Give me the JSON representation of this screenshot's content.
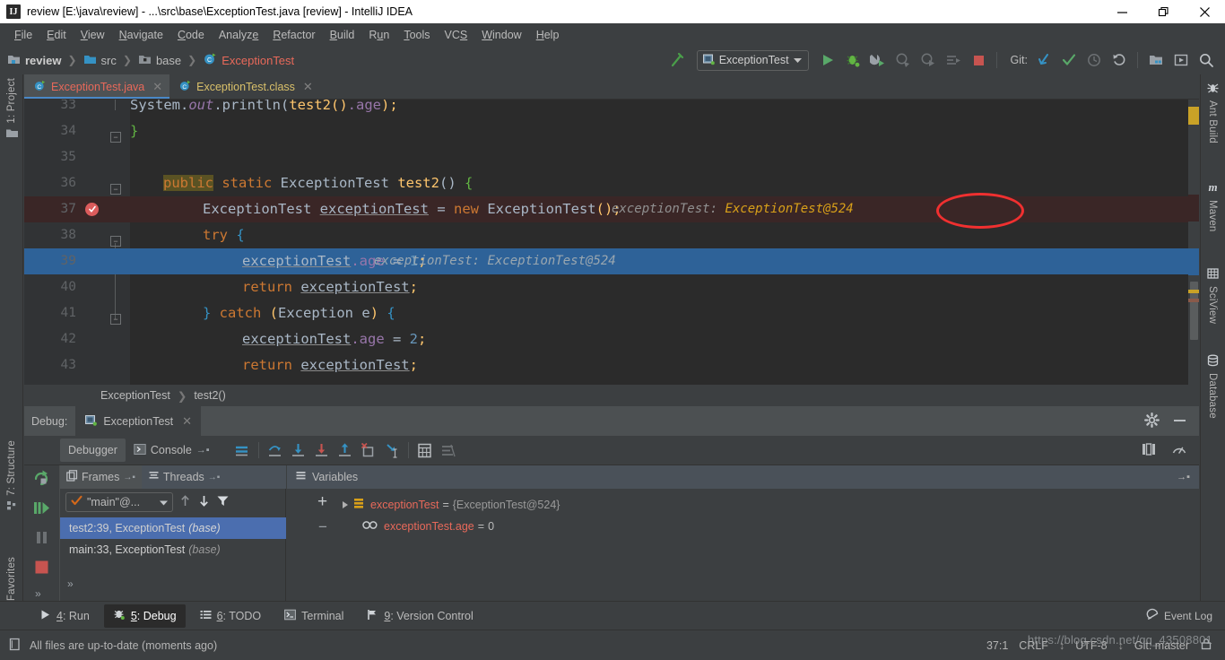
{
  "window": {
    "title": "review [E:\\java\\review] - ...\\src\\base\\ExceptionTest.java [review] - IntelliJ IDEA",
    "app_icon": "IJ",
    "minimize": "minimize-icon",
    "maximize": "restore-icon",
    "close": "close-icon"
  },
  "menu": {
    "items": [
      {
        "label": "File"
      },
      {
        "label": "Edit"
      },
      {
        "label": "View"
      },
      {
        "label": "Navigate"
      },
      {
        "label": "Code"
      },
      {
        "label": "Analyze"
      },
      {
        "label": "Refactor"
      },
      {
        "label": "Build"
      },
      {
        "label": "Run"
      },
      {
        "label": "Tools"
      },
      {
        "label": "VCS"
      },
      {
        "label": "Window"
      },
      {
        "label": "Help"
      }
    ]
  },
  "navbar": {
    "breadcrumb": [
      {
        "label": "review",
        "icon": "module-icon"
      },
      {
        "label": "src",
        "icon": "source-folder-icon"
      },
      {
        "label": "base",
        "icon": "package-icon"
      },
      {
        "label": "ExceptionTest",
        "icon": "class-icon"
      }
    ],
    "run_config": "ExceptionTest",
    "git_label": "Git:",
    "buttons": [
      {
        "name": "build-hammer-icon"
      },
      {
        "name": "run-icon"
      },
      {
        "name": "debug-icon"
      },
      {
        "name": "run-with-coverage-icon"
      },
      {
        "name": "attach-profiler-icon"
      },
      {
        "name": "profile-icon"
      },
      {
        "name": "run-anything-icon"
      },
      {
        "name": "stop-icon"
      },
      {
        "name": "update-project-icon"
      },
      {
        "name": "commit-icon"
      },
      {
        "name": "history-icon"
      },
      {
        "name": "rollback-icon"
      },
      {
        "name": "settings-icon"
      },
      {
        "name": "project-structure-icon"
      },
      {
        "name": "search-everywhere-icon"
      }
    ]
  },
  "left_tool_strip": [
    {
      "label": "1: Project",
      "icon": "folder-icon"
    },
    {
      "label": "7: Structure",
      "icon": "structure-icon"
    },
    {
      "label": "2: Favorites",
      "icon": "star-icon"
    }
  ],
  "right_tool_strip": [
    {
      "label": "Ant Build",
      "icon": "ant-icon"
    },
    {
      "label": "Maven",
      "icon": "maven-icon"
    },
    {
      "label": "SciView",
      "icon": "sciview-icon"
    },
    {
      "label": "Database",
      "icon": "database-icon"
    }
  ],
  "editor_tabs": [
    {
      "label": "ExceptionTest.java",
      "type": "java",
      "active": true
    },
    {
      "label": "ExceptionTest.class",
      "type": "class",
      "active": false
    }
  ],
  "editor": {
    "breadcrumb": [
      "ExceptionTest",
      "test2()"
    ],
    "lines": [
      {
        "num": "33",
        "state": "partial"
      },
      {
        "num": "34",
        "state": "normal"
      },
      {
        "num": "35",
        "state": "normal"
      },
      {
        "num": "36",
        "state": "normal"
      },
      {
        "num": "37",
        "state": "breakpoint"
      },
      {
        "num": "38",
        "state": "normal"
      },
      {
        "num": "39",
        "state": "execution"
      },
      {
        "num": "40",
        "state": "normal"
      },
      {
        "num": "41",
        "state": "normal"
      },
      {
        "num": "42",
        "state": "normal"
      },
      {
        "num": "43",
        "state": "normal"
      }
    ],
    "code": {
      "l33_system": "System.",
      "l33_out": "out",
      "l33_println": ".println(",
      "l33_call": "test2()",
      "l33_age": ".age",
      "l33_end": ");",
      "l34": "}",
      "l36_public": "public",
      "l36_static": " static ",
      "l36_type": "ExceptionTest",
      "l36_name": " test2",
      "l36_paren": "() ",
      "l36_brace": "{",
      "l37_type": "ExceptionTest ",
      "l37_var": "exceptionTest",
      "l37_eq": " = ",
      "l37_new": "new ",
      "l37_ctor": "ExceptionTest",
      "l37_end": "();",
      "l38_try": "try",
      "l38_brace": " {",
      "l39_var": "exceptionTest",
      "l39_field": ".age",
      "l39_eq": " = ",
      "l39_num": "1",
      "l39_semi": ";",
      "l40_return": "return ",
      "l40_var": "exceptionTest",
      "l40_semi": ";",
      "l41_brace": "} ",
      "l41_catch": "catch ",
      "l41_open": "(",
      "l41_exc": "Exception",
      "l41_e": " e",
      "l41_close": ") ",
      "l41_obrace": "{",
      "l42_var": "exceptionTest",
      "l42_field": ".age",
      "l42_eq": " = ",
      "l42_num": "2",
      "l42_semi": ";",
      "l43_return": "return ",
      "l43_var": "exceptionTest",
      "l43_semi": ";"
    },
    "inline_hints": {
      "line37_label": "exceptionTest: ",
      "line37_value": "ExceptionTest@524",
      "line39_label": "exceptionTest: ",
      "line39_value": "ExceptionTest@524"
    },
    "annotation": {
      "shape": "red-ellipse",
      "color": "#f03030"
    }
  },
  "debug": {
    "title_label": "Debug:",
    "session_tab": "ExceptionTest",
    "tabs": [
      {
        "label": "Debugger",
        "selected": true,
        "icon": null
      },
      {
        "label": "Console",
        "selected": false,
        "icon": "console-icon"
      }
    ],
    "session_controls": [
      {
        "name": "rerun-icon"
      },
      {
        "name": "resume-program-icon"
      },
      {
        "name": "pause-program-icon"
      },
      {
        "name": "stop-icon"
      },
      {
        "name": "more-chevrons-icon"
      }
    ],
    "step_buttons": [
      {
        "name": "show-execution-point-icon"
      },
      {
        "name": "step-over-icon"
      },
      {
        "name": "step-into-icon"
      },
      {
        "name": "force-step-into-icon"
      },
      {
        "name": "step-out-icon"
      },
      {
        "name": "drop-frame-icon"
      },
      {
        "name": "run-to-cursor-icon"
      },
      {
        "name": "evaluate-expression-icon"
      },
      {
        "name": "mute-breakpoints-icon"
      }
    ],
    "header_right": [
      {
        "name": "settings-gear-icon"
      },
      {
        "name": "hide-icon"
      }
    ],
    "toolbar_right": [
      {
        "name": "layout-icon"
      },
      {
        "name": "performance-icon"
      }
    ],
    "frames": {
      "tab_frames": "Frames",
      "tab_threads": "Threads",
      "thread_selector": "\"main\"@...",
      "items": [
        {
          "label": "test2:39, ExceptionTest",
          "suffix": "(base)",
          "selected": true
        },
        {
          "label": "main:33, ExceptionTest",
          "suffix": "(base)",
          "selected": false
        }
      ],
      "buttons": [
        {
          "name": "arrow-up-icon"
        },
        {
          "name": "arrow-down-icon"
        },
        {
          "name": "filter-icon"
        }
      ]
    },
    "variables": {
      "header": "Variables",
      "add_button": "+",
      "remove_button": "−",
      "rows": [
        {
          "expandable": true,
          "icon": "object-icon",
          "name": "exceptionTest",
          "eq": "=",
          "value": "{ExceptionTest@524}",
          "indent": 0
        },
        {
          "expandable": false,
          "icon": "watch-icon",
          "name": "exceptionTest.age",
          "eq": "=",
          "value": "0",
          "indent": 1
        }
      ]
    }
  },
  "bottom_bar": {
    "items": [
      {
        "label": "4: Run",
        "icon": "run-icon",
        "selected": false
      },
      {
        "label": "5: Debug",
        "icon": "debug-bug-icon",
        "selected": true
      },
      {
        "label": "6: TODO",
        "icon": "todo-icon",
        "selected": false
      },
      {
        "label": "Terminal",
        "icon": "terminal-icon",
        "selected": false
      },
      {
        "label": "9: Version Control",
        "icon": "vcs-icon",
        "selected": false
      }
    ],
    "event_log": "Event Log"
  },
  "status_bar": {
    "message": "All files are up-to-date (moments ago)",
    "caret_position": "37:1",
    "line_separator": "CRLF",
    "encoding": "UTF-8",
    "branch": "Git: master",
    "watermark": "https://blog.csdn.net/qq_43508801"
  },
  "colors": {
    "accent_blue": "#4b6eaf",
    "execution_line": "#2e6298",
    "breakpoint_line": "#3a2626",
    "editor_bg": "#2b2b2b",
    "panel_bg": "#3c3f41",
    "annotation_red": "#f03030",
    "keyword_orange": "#cc7832",
    "method_yellow": "#ffc66d"
  }
}
